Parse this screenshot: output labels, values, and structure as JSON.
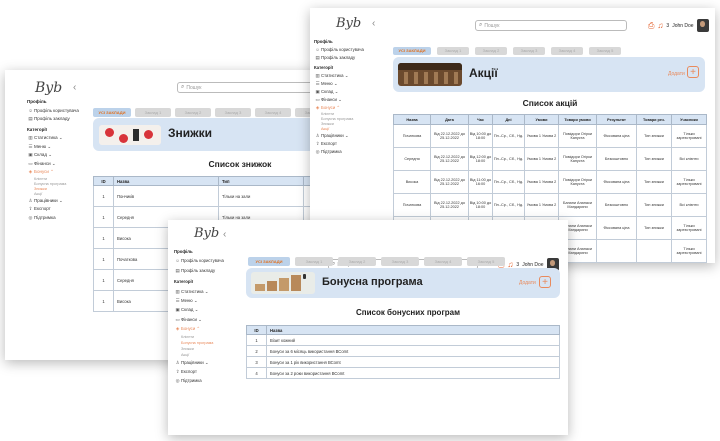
{
  "logo": "Byb",
  "search_placeholder": "Пошук",
  "user": {
    "notif_count": "3",
    "name": "John Doe"
  },
  "sidebar": {
    "profile_title": "Профіль",
    "profile_items": [
      "Профіль користувача",
      "Профіль закладу"
    ],
    "categories_title": "Категорії",
    "nav": [
      "Статистика",
      "Меню",
      "Склад",
      "Фінанси",
      "Бонуси",
      "Працівники",
      "Експорт",
      "Підтримка"
    ],
    "bonus_sub": [
      "Клієнти",
      "Бонусна програма",
      "Знижки",
      "Акції"
    ]
  },
  "tabs": [
    "УСІ ЗАКЛАДИ",
    "Заклад 1",
    "Заклад 2",
    "Заклад 3",
    "Заклад 4",
    "Заклад 5"
  ],
  "add_label": "Додати",
  "add_symbol": "+",
  "icons": {
    "search": "search-icon",
    "bell": "bell-icon",
    "printer": "printer-icon"
  },
  "colors": {
    "accent": "#e98a5c",
    "banner": "#d7e4f3",
    "header_row": "#d7e4f3"
  },
  "discounts": {
    "banner_title": "Знижки",
    "list_title": "Список знижок",
    "columns": [
      "ID",
      "Назва",
      "Тип",
      ""
    ],
    "rows": [
      [
        "1",
        "Пончиків",
        "Тільки на зали",
        ""
      ],
      [
        "1",
        "Середня",
        "Тільки на зали",
        ""
      ],
      [
        "1",
        "Висока",
        "",
        ""
      ],
      [
        "1",
        "Початкова",
        "",
        ""
      ],
      [
        "1",
        "Середня",
        "",
        ""
      ],
      [
        "1",
        "Висока",
        "",
        ""
      ]
    ]
  },
  "promos": {
    "banner_title": "Акції",
    "list_title": "Список акцій",
    "columns": [
      "Назва",
      "Дата",
      "Час",
      "Дні",
      "Умови",
      "Товари умови",
      "Результат",
      "Товари рез.",
      "Учасники"
    ],
    "rows": [
      [
        "Початкова",
        "Від 22.12.2022 до 25.12.2022",
        "Від 10:00 до 18:00",
        "Пн.-Ср., Сб., Нд.",
        "Умова 1 Умова 2",
        "Помідори Огірки Капуста",
        "Фіксована ціна",
        "Тип знижки",
        "Тільки зареєстровані"
      ],
      [
        "Середня",
        "Від 22.12.2022 до 25.12.2022",
        "Від 12:00 до 18:00",
        "Пн.-Ср., Сб., Нд.",
        "Умова 1 Умова 2",
        "Помідори Огірки Капуста",
        "Безкоштовно",
        "Тип знижки",
        "Всі клієнти"
      ],
      [
        "Висока",
        "Від 22.12.2022 до 25.12.2022",
        "Від 11:00 до 16:00",
        "Пн.-Ср., Сб., Нд.",
        "Умова 1 Умова 2",
        "Помідори Огірки Капуста",
        "Фіксована ціна",
        "Тип знижки",
        "Тільки зареєстровані"
      ],
      [
        "Початкова",
        "Від 22.12.2022 до 25.12.2022",
        "Від 10:00 до 18:00",
        "Пн.-Ср., Сб., Нд.",
        "Умова 1 Умова 2",
        "Банани Ананаси Мандарини",
        "Безкоштовно",
        "Тип знижки",
        "Всі клієнти"
      ],
      [
        "Середня",
        "Від 22.12.2022 до 25.12.2022",
        "Від 12:00 до 18:00",
        "Пн.-Ср., Сб., Нд.",
        "Умова 1 Умова 2",
        "Банани Ананаси Мандарини",
        "Фіксована ціна",
        "Тип знижки",
        "Тільки зареєстровані"
      ],
      [
        "",
        "",
        "",
        "",
        "",
        "Банани Ананаси Мандарини",
        "",
        "",
        "Тільки зареєстровані"
      ]
    ]
  },
  "bonus": {
    "banner_title": "Бонусна програма",
    "list_title": "Список бонусних програм",
    "columns": [
      "ID",
      "Назва"
    ],
    "rows": [
      [
        "1",
        "Візит кожний"
      ],
      [
        "2",
        "Бонуси за 6 місяць використання ВСоmt"
      ],
      [
        "3",
        "Бонуси за 1 рік використання ВСоmt"
      ],
      [
        "4",
        "Бонуси за 2 роки використання ВСоmt"
      ]
    ]
  }
}
